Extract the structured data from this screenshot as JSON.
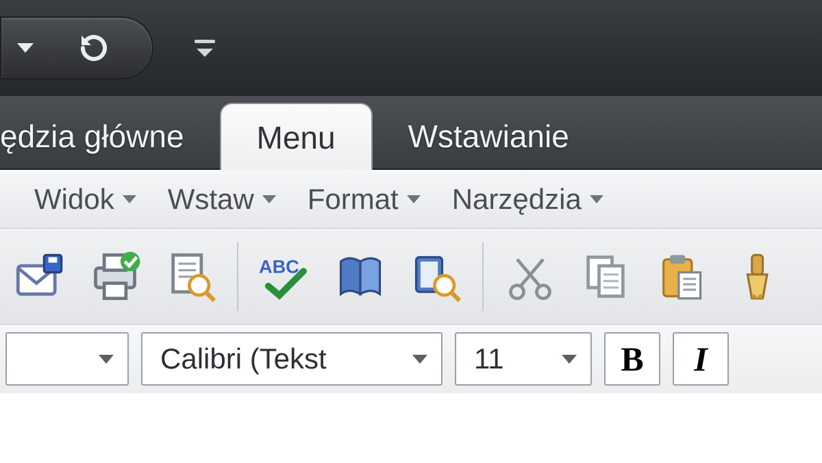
{
  "tabs": {
    "tools_main": "ędzia główne",
    "menu": "Menu",
    "insert": "Wstawianie"
  },
  "menus": {
    "view": "Widok",
    "insert": "Wstaw",
    "format": "Format",
    "tools": "Narzędzia"
  },
  "font": {
    "name": "Calibri (Tekst",
    "size": "11",
    "bold_label": "B",
    "italic_label": "I"
  },
  "icons": {
    "qat_dropdown": "dropdown",
    "qat_refresh": "refresh",
    "ribbon_minimize": "minimize-ribbon",
    "save_send": "save-send",
    "quick_print": "quick-print",
    "print_preview": "print-preview",
    "spellcheck": "spellcheck",
    "research": "research",
    "thesaurus": "thesaurus",
    "cut": "cut",
    "copy": "copy",
    "paste": "paste",
    "format_painter": "format-painter"
  }
}
